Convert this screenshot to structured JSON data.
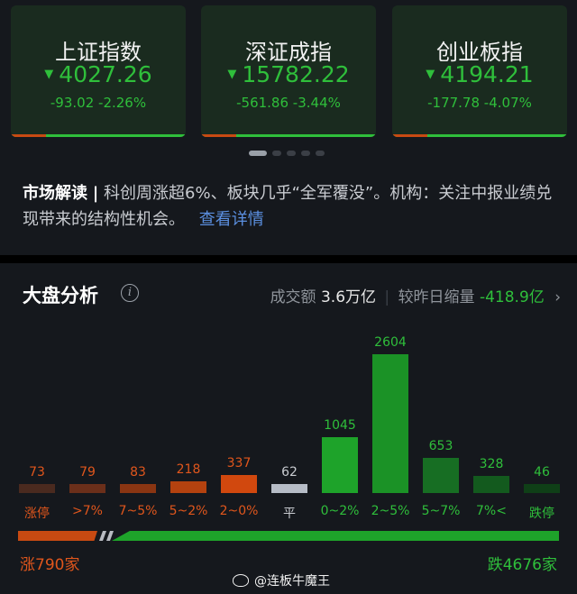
{
  "indices": [
    {
      "name": "上证指数",
      "price": "4027.26",
      "change": "-93.02",
      "pct": "-2.26%"
    },
    {
      "name": "深证成指",
      "price": "15782.22",
      "change": "-561.86",
      "pct": "-3.44%"
    },
    {
      "name": "创业板指",
      "price": "4194.21",
      "change": "-177.78",
      "pct": "-4.07%"
    }
  ],
  "carousel": {
    "count": 5,
    "active": 0
  },
  "market_note": {
    "head": "市场解读",
    "separator": "|",
    "text": "科创周涨超6%、板块几乎“全军覆没”。机构：关注中报业绩兑现带来的结构性机会。",
    "link": "查看详情"
  },
  "analysis": {
    "title": "大盘分析",
    "info_icon": "info-icon",
    "volume_label": "成交额",
    "volume_value": "3.6万亿",
    "vs_label": "较昨日缩量",
    "vs_value": "-418.9亿",
    "chevron": "chevron-right-icon"
  },
  "chart_data": {
    "type": "bar",
    "categories": [
      "涨停",
      ">7%",
      "7~5%",
      "5~2%",
      "2~0%",
      "平",
      "0~2%",
      "2~5%",
      "5~7%",
      "7%<",
      "跌停"
    ],
    "values": [
      73,
      79,
      83,
      218,
      337,
      62,
      1045,
      2604,
      653,
      328,
      46
    ],
    "colors": [
      "#4a2a1f",
      "#6b2f1a",
      "#8a3512",
      "#b4420f",
      "#d1480e",
      "#b6bcc6",
      "#1ea32a",
      "#1b9226",
      "#176e23",
      "#135a1e",
      "#0f3f17"
    ],
    "label_colors": [
      "#e0561c",
      "#e0561c",
      "#e0561c",
      "#e0561c",
      "#e0561c",
      "#c9ccd1",
      "#2fbf3b",
      "#2fbf3b",
      "#2fbf3b",
      "#2fbf3b",
      "#2fbf3b"
    ],
    "ylim": [
      0,
      2604
    ]
  },
  "ratio": {
    "up_label": "涨790家",
    "down_label": "跌4676家",
    "up": 790,
    "down": 4676
  },
  "watermark": "@连板牛魔王",
  "colors": {
    "up": "#e0561c",
    "down": "#2fbf3b",
    "card_bg": "#1a2b1f",
    "panel_bg": "#15181d"
  }
}
